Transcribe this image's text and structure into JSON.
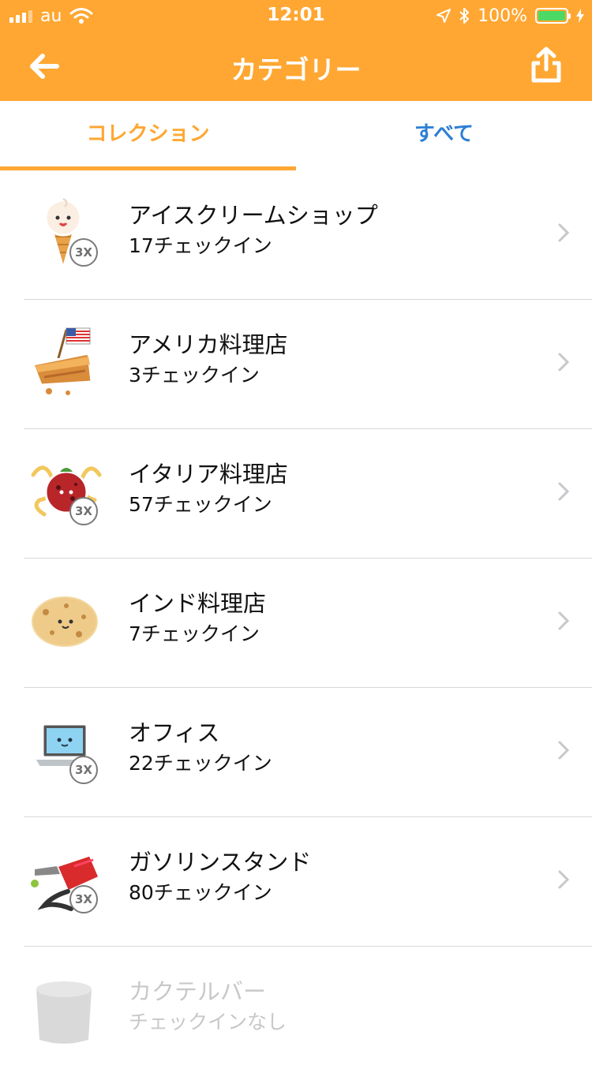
{
  "status_bar": {
    "carrier": "au",
    "time": "12:01",
    "battery": "100%"
  },
  "nav": {
    "title": "カテゴリー",
    "back_icon": "arrow-left-icon",
    "share_icon": "share-icon"
  },
  "tabs": [
    {
      "label": "コレクション",
      "active": true
    },
    {
      "label": "すべて",
      "active": false
    }
  ],
  "colors": {
    "brand_orange": "#FFA732",
    "tab_blue": "#2d7fd4",
    "battery_green": "#4cd964"
  },
  "categories": [
    {
      "name": "アイスクリームショップ",
      "count": "17チェックイン",
      "badge": "3X",
      "icon": "ice-cream-icon"
    },
    {
      "name": "アメリカ料理店",
      "count": "3チェックイン",
      "badge": "",
      "icon": "apple-pie-icon"
    },
    {
      "name": "イタリア料理店",
      "count": "57チェックイン",
      "badge": "3X",
      "icon": "meatball-pasta-icon"
    },
    {
      "name": "インド料理店",
      "count": "7チェックイン",
      "badge": "",
      "icon": "naan-icon"
    },
    {
      "name": "オフィス",
      "count": "22チェックイン",
      "badge": "3X",
      "icon": "laptop-icon"
    },
    {
      "name": "ガソリンスタンド",
      "count": "80チェックイン",
      "badge": "3X",
      "icon": "gas-pump-icon"
    },
    {
      "name": "カクテルバー",
      "count": "チェックインなし",
      "badge": "",
      "icon": "cocktail-glass-placeholder-icon"
    }
  ]
}
